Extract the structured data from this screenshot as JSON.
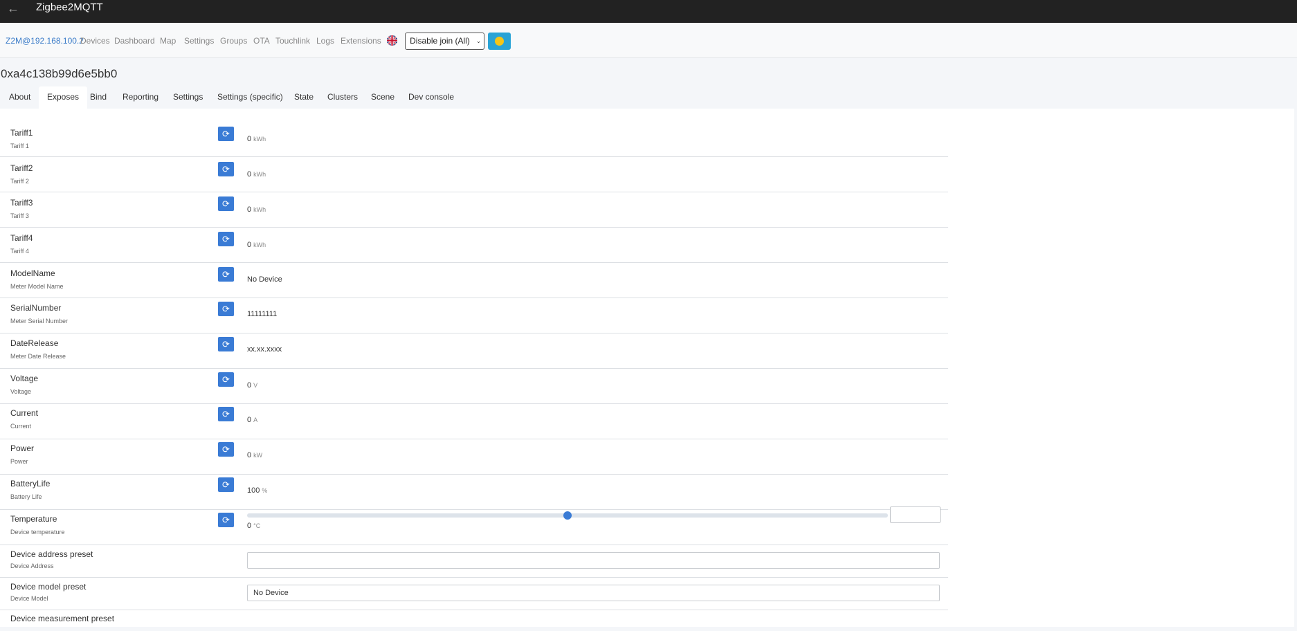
{
  "app": {
    "title": "Zigbee2MQTT",
    "back_icon": "arrow-left-icon"
  },
  "nav": {
    "brand": "Z2M@192.168.100.2",
    "items": [
      "Devices",
      "Dashboard",
      "Map",
      "Settings",
      "Groups",
      "OTA",
      "Touchlink",
      "Logs",
      "Extensions"
    ],
    "join_button": "Disable join (All)",
    "language_icon": "uk-flag-icon",
    "theme_icon": "smiley-icon"
  },
  "device": {
    "id": "0xa4c138b99d6e5bb0"
  },
  "tabs": [
    "About",
    "Exposes",
    "Bind",
    "Reporting",
    "Settings",
    "Settings (specific)",
    "State",
    "Clusters",
    "Scene",
    "Dev console"
  ],
  "active_tab": "Exposes",
  "exposes": [
    {
      "label": "Tariff1",
      "sub": "Tariff 1",
      "value": "0",
      "unit": "kWh"
    },
    {
      "label": "Tariff2",
      "sub": "Tariff 2",
      "value": "0",
      "unit": "kWh"
    },
    {
      "label": "Tariff3",
      "sub": "Tariff 3",
      "value": "0",
      "unit": "kWh"
    },
    {
      "label": "Tariff4",
      "sub": "Tariff 4",
      "value": "0",
      "unit": "kWh"
    },
    {
      "label": "ModelName",
      "sub": "Meter Model Name",
      "value": "No Device",
      "unit": ""
    },
    {
      "label": "SerialNumber",
      "sub": "Meter Serial Number",
      "value": "11111111",
      "unit": ""
    },
    {
      "label": "DateRelease",
      "sub": "Meter Date Release",
      "value": "xx.xx.xxxx",
      "unit": ""
    },
    {
      "label": "Voltage",
      "sub": "Voltage",
      "value": "0",
      "unit": "V"
    },
    {
      "label": "Current",
      "sub": "Current",
      "value": "0",
      "unit": "A"
    },
    {
      "label": "Power",
      "sub": "Power",
      "value": "0",
      "unit": "kW"
    },
    {
      "label": "BatteryLife",
      "sub": "Battery Life",
      "value": "100",
      "unit": "%"
    },
    {
      "label": "Temperature",
      "sub": "Device temperature",
      "value": "0",
      "unit": "°C"
    }
  ],
  "presets": [
    {
      "label": "Device address preset",
      "sub": "Device Address",
      "value": ""
    },
    {
      "label": "Device model preset",
      "sub": "Device Model",
      "value": "No Device"
    },
    {
      "label": "Device measurement preset"
    }
  ],
  "colors": {
    "topbar": "#222222",
    "accent": "#3a7bd5",
    "brand_link": "#3a7bc8",
    "theme_button": "#29a3d6"
  }
}
